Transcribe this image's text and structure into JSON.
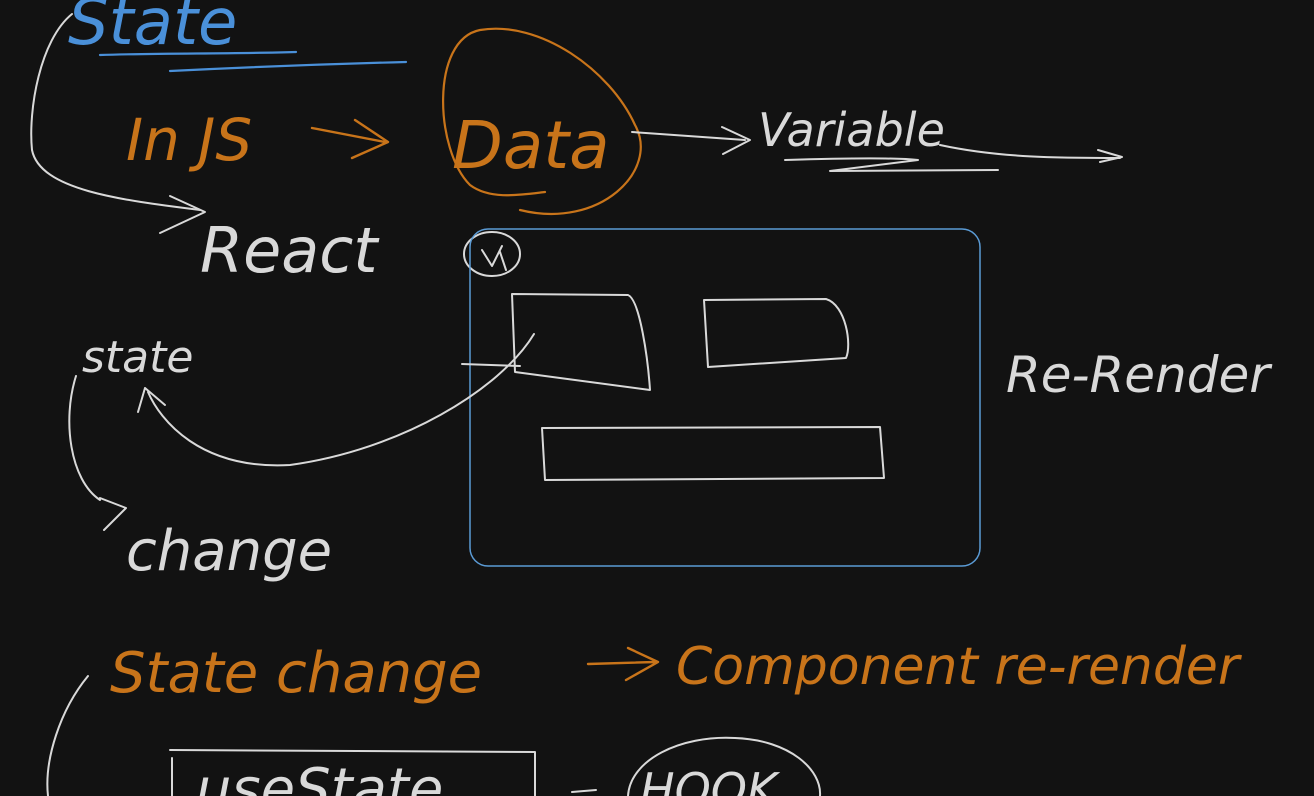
{
  "colors": {
    "background": "#121212",
    "white_ink": "#d9d9d9",
    "orange_ink": "#c8741a",
    "blue_ink": "#4a90d9",
    "frame": "#5b9bd5"
  },
  "notes": {
    "heading": "State",
    "in_js": "In JS",
    "data": "Data",
    "variable": "Variable",
    "react": "React",
    "state": "state",
    "change": "change",
    "re_render": "Re-Render",
    "summary_left": "State change",
    "summary_right": "Component re-render",
    "use_state": "useState",
    "hook": "HOOK"
  }
}
